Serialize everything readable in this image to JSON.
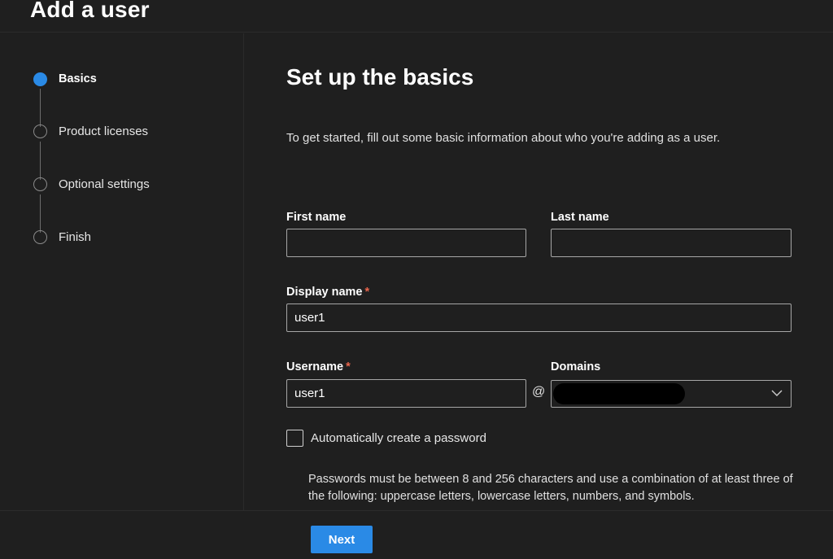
{
  "header": {
    "title": "Add a user"
  },
  "stepper": {
    "steps": [
      {
        "label": "Basics",
        "state": "active"
      },
      {
        "label": "Product licenses",
        "state": "pending"
      },
      {
        "label": "Optional settings",
        "state": "pending"
      },
      {
        "label": "Finish",
        "state": "pending"
      }
    ]
  },
  "main": {
    "title": "Set up the basics",
    "intro": "To get started, fill out some basic information about who you're adding as a user.",
    "first_name": {
      "label": "First name",
      "value": ""
    },
    "last_name": {
      "label": "Last name",
      "value": ""
    },
    "display_name": {
      "label": "Display name",
      "required_mark": "*",
      "value": "user1"
    },
    "username": {
      "label": "Username",
      "required_mark": "*",
      "value": "user1"
    },
    "at_sign": "@",
    "domains": {
      "label": "Domains",
      "value_redacted": true
    },
    "auto_password": {
      "label": "Automatically create a password",
      "checked": false
    },
    "password_help": "Passwords must be between 8 and 256 characters and use a combination of at least three of the following: uppercase letters, lowercase letters, numbers, and symbols."
  },
  "footer": {
    "next_label": "Next"
  },
  "colors": {
    "background": "#1f1f1f",
    "accent": "#2a8ae6",
    "required": "#e8654c",
    "input_border": "#a6a6a6"
  }
}
